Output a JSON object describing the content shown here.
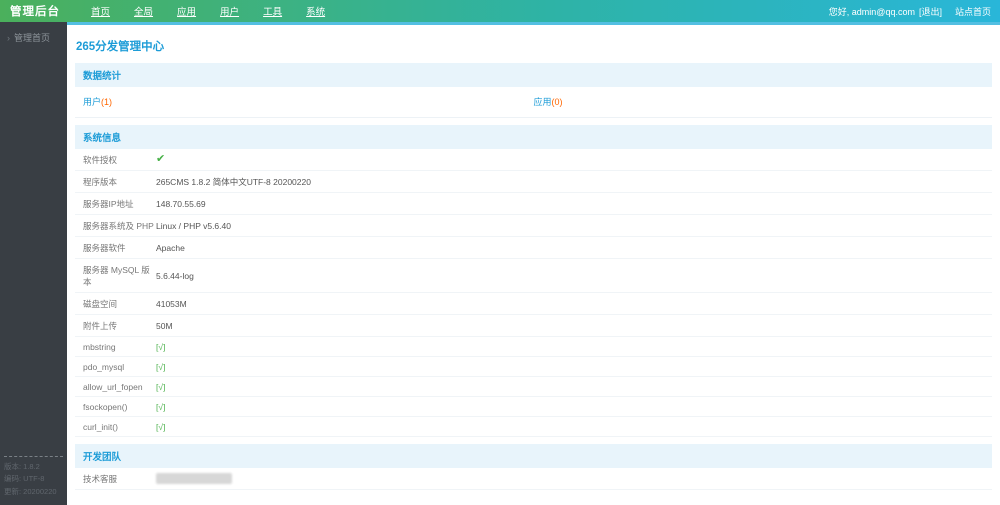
{
  "header": {
    "brand": "管理后台",
    "menu": [
      "首页",
      "全局",
      "应用",
      "用户",
      "工具",
      "系统"
    ],
    "greeting": "您好, admin@qq.com",
    "logout_label": "[退出]",
    "site_home_label": "站点首页"
  },
  "sidebar": {
    "items": [
      {
        "label": "管理首页"
      }
    ],
    "footer_lines": [
      "版本: 1.8.2",
      "编码: UTF-8",
      "更新: 20200220"
    ]
  },
  "main": {
    "page_title": "265分发管理中心",
    "stats": {
      "header": "数据统计",
      "items": [
        {
          "label": "用户",
          "count": "(1)"
        },
        {
          "label": "应用",
          "count": "(0)"
        }
      ]
    },
    "sysinfo": {
      "header": "系统信息",
      "rows": [
        {
          "label": "软件授权",
          "value": "✔",
          "type": "check"
        },
        {
          "label": "程序版本",
          "value": "265CMS 1.8.2 简体中文UTF-8 20200220",
          "type": "text"
        },
        {
          "label": "服务器IP地址",
          "value": "148.70.55.69",
          "type": "text"
        },
        {
          "label": "服务器系统及 PHP",
          "value": "Linux / PHP v5.6.40",
          "type": "text"
        },
        {
          "label": "服务器软件",
          "value": "Apache",
          "type": "text"
        },
        {
          "label": "服务器 MySQL 版本",
          "value": "5.6.44-log",
          "type": "text"
        },
        {
          "label": "磁盘空间",
          "value": "41053M",
          "type": "text"
        },
        {
          "label": "附件上传",
          "value": "50M",
          "type": "text"
        },
        {
          "label": "mbstring",
          "value": "[√]",
          "type": "ok"
        },
        {
          "label": "pdo_mysql",
          "value": "[√]",
          "type": "ok"
        },
        {
          "label": "allow_url_fopen",
          "value": "[√]",
          "type": "ok"
        },
        {
          "label": "fsockopen()",
          "value": "[√]",
          "type": "ok"
        },
        {
          "label": "curl_init()",
          "value": "[√]",
          "type": "ok"
        }
      ]
    },
    "team": {
      "header": "开发团队",
      "rows": [
        {
          "label": "技术客服",
          "value": "",
          "type": "blur"
        }
      ]
    }
  },
  "colors": {
    "header_gradient_left": "#4bb05c",
    "header_gradient_right": "#29b6d9",
    "accent_blue": "#1d9cd7",
    "count_orange": "#ff6600",
    "ok_green": "#4db14d",
    "sidebar_bg": "#393e44",
    "section_bar_bg": "#e8f4fb",
    "topline_blue": "#53bfe2"
  }
}
